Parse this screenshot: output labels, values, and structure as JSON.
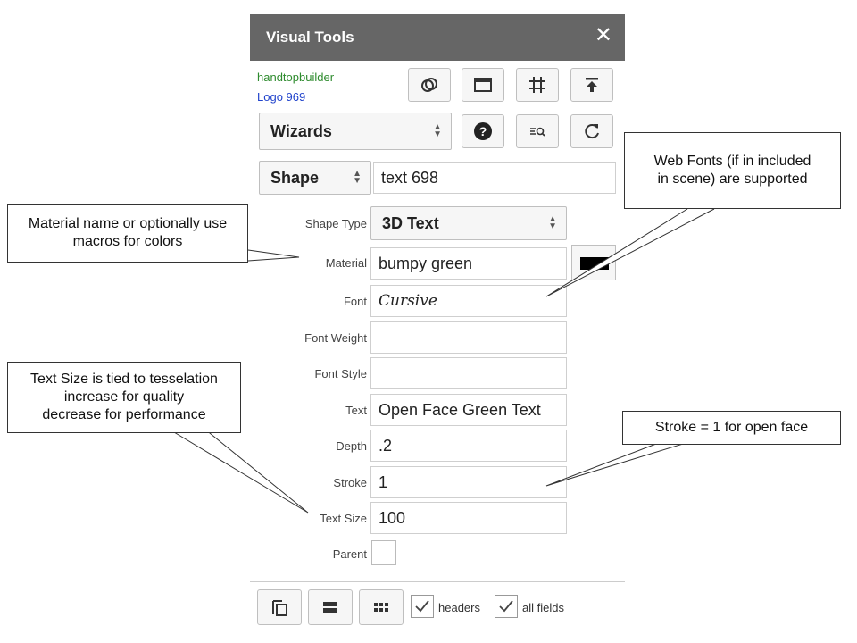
{
  "panel": {
    "title": "Visual Tools",
    "close_glyph": "✕"
  },
  "info": {
    "owner": "handtopbuilder",
    "logo": "Logo 969"
  },
  "toolbar": {
    "icons": [
      "link-rings-icon",
      "window-icon",
      "grid-icon",
      "upload-icon",
      "help-icon",
      "list-search-icon",
      "refresh-icon"
    ]
  },
  "wizards": {
    "label": "Wizards"
  },
  "shape": {
    "type_select": "Shape",
    "name": "text 698"
  },
  "form": {
    "shape_type": {
      "label": "Shape Type",
      "value": "3D Text"
    },
    "material": {
      "label": "Material",
      "value": "bumpy green",
      "swatch_color": "#000000"
    },
    "font": {
      "label": "Font",
      "value": "Cursive"
    },
    "font_weight": {
      "label": "Font Weight",
      "value": ""
    },
    "font_style": {
      "label": "Font Style",
      "value": ""
    },
    "text": {
      "label": "Text",
      "value": "Open Face Green Text"
    },
    "depth": {
      "label": "Depth",
      "value": ".2"
    },
    "stroke": {
      "label": "Stroke",
      "value": "1"
    },
    "text_size": {
      "label": "Text Size",
      "value": "100"
    },
    "parent": {
      "label": "Parent"
    }
  },
  "footer": {
    "headers_label": "headers",
    "headers_checked": true,
    "all_fields_label": "all fields",
    "all_fields_checked": true
  },
  "callouts": {
    "material": "Material name or optionally use macros for colors",
    "fonts_line1": "Web Fonts (if in included",
    "fonts_line2": "in scene) are supported",
    "textsize_line1": "Text Size is tied to tesselation",
    "textsize_line2": "increase for quality",
    "textsize_line3": "decrease for performance",
    "stroke": "Stroke = 1 for open face"
  }
}
